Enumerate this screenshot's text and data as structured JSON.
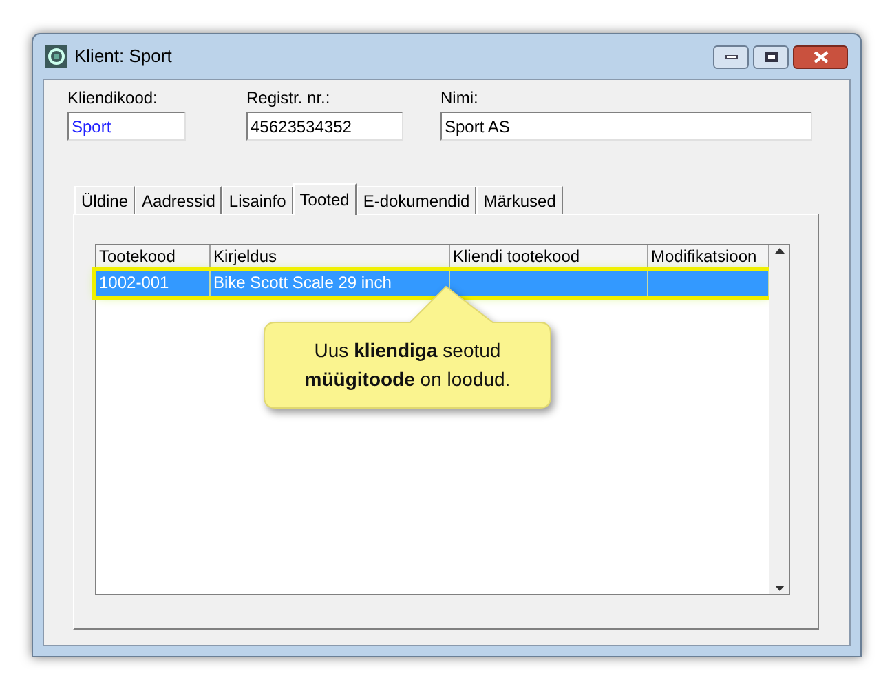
{
  "window": {
    "title": "Klient: Sport"
  },
  "fields": [
    {
      "label": "Kliendikood:",
      "value": "Sport",
      "highlighted": true
    },
    {
      "label": "Registr. nr.:",
      "value": "45623534352",
      "highlighted": false
    },
    {
      "label": "Nimi:",
      "value": "Sport AS",
      "highlighted": false
    }
  ],
  "tabs": [
    {
      "label": "Üldine",
      "selected": false
    },
    {
      "label": "Aadressid",
      "selected": false
    },
    {
      "label": "Lisainfo",
      "selected": false
    },
    {
      "label": "Tooted",
      "selected": true
    },
    {
      "label": "E-dokumendid",
      "selected": false
    },
    {
      "label": "Märkused",
      "selected": false
    }
  ],
  "table": {
    "columns": [
      "Tootekood",
      "Kirjeldus",
      "Kliendi tootekood",
      "Modifikatsioon"
    ],
    "rows": [
      {
        "cells": [
          "1002-001",
          "Bike Scott Scale 29 inch",
          "",
          ""
        ],
        "selected": true
      }
    ]
  },
  "callout": {
    "text": "Uus **kliendiga** seotud **müügitoode** on loodud."
  }
}
